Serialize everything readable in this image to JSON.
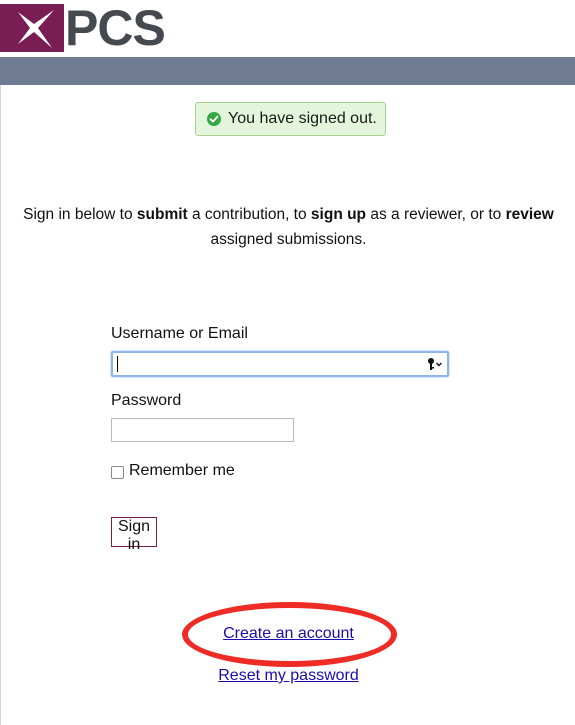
{
  "header": {
    "logo_text": "PCS",
    "brand_color": "#7a1d55",
    "navbar_color": "#6e7b92"
  },
  "notice": {
    "message": "You have signed out.",
    "icon": "check-circle-icon",
    "status_color": "#34a844"
  },
  "intro": {
    "part1": "Sign in below to ",
    "bold1": "submit",
    "part2": " a contribution, to ",
    "bold2": "sign up",
    "part3": " as a reviewer, or to ",
    "bold3": "review",
    "part4": "assigned submissions."
  },
  "form": {
    "username_label": "Username or Email",
    "username_value": "",
    "password_label": "Password",
    "password_value": "",
    "remember_label": "Remember me",
    "remember_checked": false,
    "signin_label": "Sign in"
  },
  "links": {
    "create_account": "Create an account",
    "reset_password": "Reset my password"
  },
  "annotation": {
    "highlight_color": "#ee2b24"
  }
}
